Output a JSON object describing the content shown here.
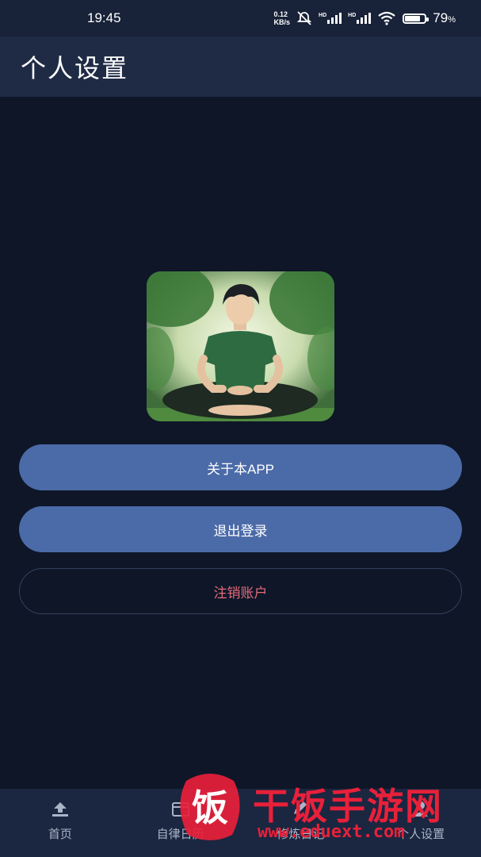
{
  "status_bar": {
    "time": "19:45",
    "net_speed_value": "0.12",
    "net_speed_unit": "KB/s",
    "hd1": "HD",
    "hd2": "HD",
    "battery_percent": "79",
    "battery_suffix": "%",
    "battery_level": 0.79
  },
  "header": {
    "title": "个人设置"
  },
  "buttons": {
    "about": "关于本APP",
    "logout": "退出登录",
    "delete_account": "注销账户"
  },
  "bottom_nav": {
    "items": [
      {
        "label": "首页",
        "icon": "upload-arrow-icon"
      },
      {
        "label": "自律日历",
        "icon": "calendar-icon"
      },
      {
        "label": "修炼日记",
        "icon": "pen-icon"
      },
      {
        "label": "个人设置",
        "icon": "person-icon"
      }
    ]
  },
  "watermark": {
    "text": "干饭手游网",
    "url": "www.eduext.com",
    "logo_char": "饭"
  },
  "colors": {
    "background": "#0e1628",
    "app_bar": "#1f2b45",
    "primary_button": "#4b6aa8",
    "danger_text": "#e46b78",
    "watermark": "#e8203a"
  }
}
